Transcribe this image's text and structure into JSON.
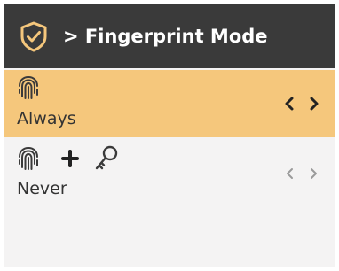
{
  "header": {
    "title": "> Fingerprint Mode",
    "icon": "shield-check-icon"
  },
  "options": [
    {
      "label": "Always",
      "icons": [
        "fingerprint-icon"
      ],
      "selected": true
    },
    {
      "label": "Never",
      "icons": [
        "fingerprint-icon",
        "plus-icon",
        "key-icon"
      ],
      "selected": false
    }
  ],
  "colors": {
    "header_bg": "#3a3a3a",
    "header_text": "#ffffff",
    "selected_bg": "#f5c77c",
    "unselected_bg": "#f4f3f3",
    "accent": "#f5c77c",
    "arrow_active": "#222222",
    "arrow_inactive": "#9a9a9a"
  }
}
